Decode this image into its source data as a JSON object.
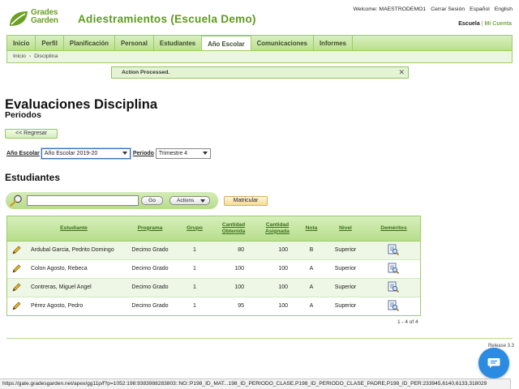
{
  "header": {
    "logo_line1": "Grades",
    "logo_line2": "Garden",
    "app_title": "Adiestramientos (Escuela Demo)",
    "welcome": "Welcome: MAESTRODEMO1",
    "logout": "Cerrar Sesión",
    "lang_es": "Español",
    "lang_en": "English",
    "scope_active": "Escuela",
    "scope_inactive": "Mi Cuenta"
  },
  "nav": {
    "tabs": [
      {
        "label": "Inicio"
      },
      {
        "label": "Perfil"
      },
      {
        "label": "Planificación"
      },
      {
        "label": "Personal"
      },
      {
        "label": "Estudiantes"
      },
      {
        "label": "Año Escolar"
      },
      {
        "label": "Comunicaciones"
      },
      {
        "label": "Informes"
      }
    ],
    "active_tab": "Año Escolar"
  },
  "breadcrumb": {
    "home": "Inicio",
    "current": "Disciplina"
  },
  "alert": {
    "message": "Action Processed.",
    "close": "✕"
  },
  "page": {
    "title": "Evaluaciones Disciplina",
    "subtitle": "Periodos",
    "back_button": "<< Regresar",
    "filter_year_label": "Año Escolar",
    "filter_year_value": "Año Escolar 2019-20",
    "filter_period_label": "Periodo",
    "filter_period_value": "Trimestre 4",
    "section_title": "Estudiantes"
  },
  "toolbar": {
    "search_value": "",
    "go_label": "Go",
    "actions_label": "Actions",
    "enroll_label": "Matricular"
  },
  "table": {
    "headers": {
      "student": "Estudiante",
      "program": "Programa",
      "group": "Grupo",
      "obtained1": "Cantidad",
      "obtained2": "Obtenida",
      "assigned1": "Cantidad",
      "assigned2": "Asignada",
      "grade": "Nota",
      "level": "Nivel",
      "demerits": "Deméritos"
    },
    "rows": [
      {
        "student": "Ardubal Garcia, Pedrito Domingo",
        "program": "Decimo Grado",
        "group": "1",
        "obtained": "80",
        "assigned": "100",
        "grade": "B",
        "level": "Superior"
      },
      {
        "student": "Colon Agosto, Rebeca",
        "program": "Decimo Grado",
        "group": "1",
        "obtained": "100",
        "assigned": "100",
        "grade": "A",
        "level": "Superior"
      },
      {
        "student": "Contreras, Miguel Angel",
        "program": "Decimo Grado",
        "group": "1",
        "obtained": "100",
        "assigned": "100",
        "grade": "A",
        "level": "Superior"
      },
      {
        "student": "Pérez Agosto, Pedro",
        "program": "Decimo Grado",
        "group": "1",
        "obtained": "95",
        "assigned": "100",
        "grade": "A",
        "level": "Superior"
      }
    ]
  },
  "pagination": "1 - 4 of 4",
  "release": "Release 3.3",
  "status_url": "https://gate.gradesgarden.net/apex/gg11p/f?p=1052:198:9383988283803::NO::P198_ID_MAT...198_ID_PERIODO_CLASE,P198_ID_PERIODO_CLASE_PADRE,P198_ID_PER:233945,6140,6133,318029",
  "colors": {
    "brand_green": "#5d9a1d",
    "nav_green": "#b9df8c",
    "fab_blue": "#2b8be0"
  }
}
